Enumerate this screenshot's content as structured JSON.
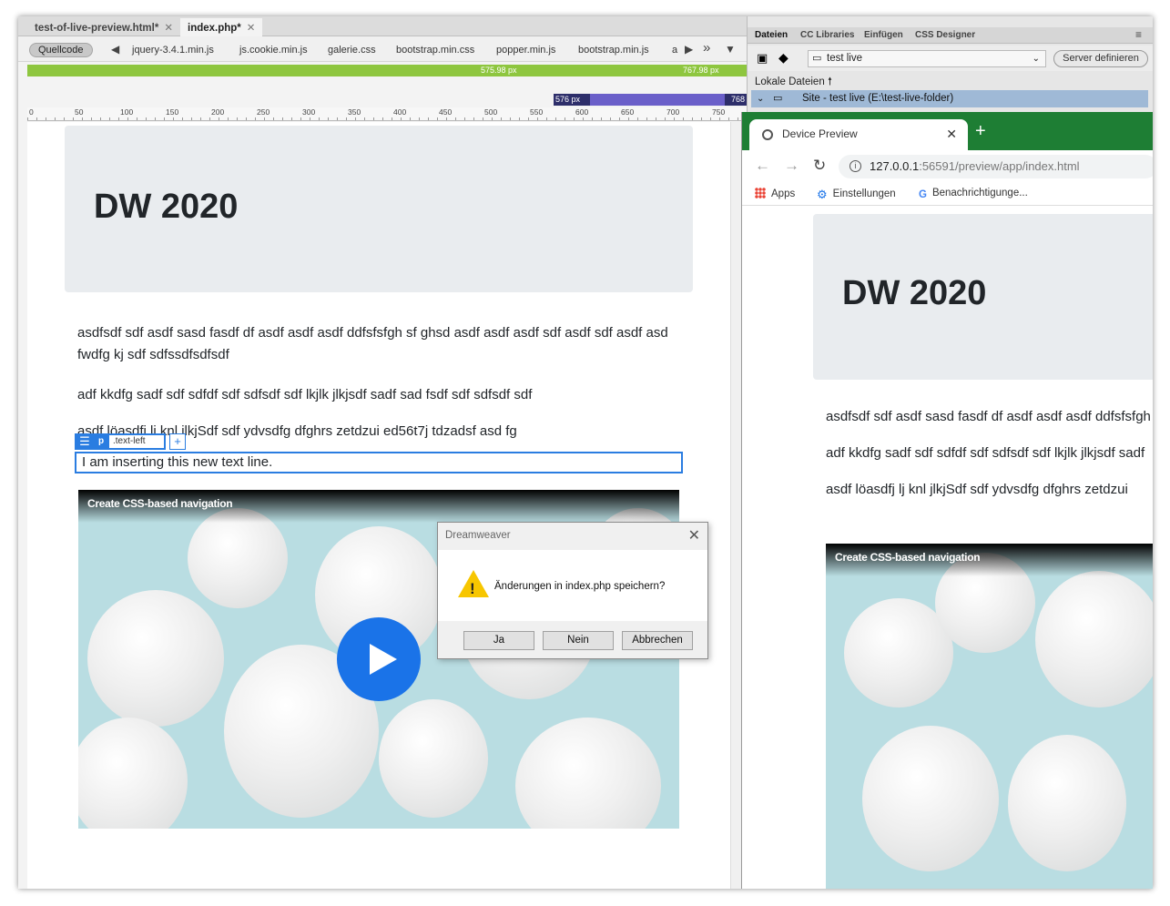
{
  "doc_tabs": [
    {
      "label": "test-of-live-preview.html*"
    },
    {
      "label": "index.php*"
    }
  ],
  "related": {
    "source_pill": "Quellcode",
    "files": [
      "jquery-3.4.1.min.js",
      "js.cookie.min.js",
      "galerie.css",
      "bootstrap.min.css",
      "popper.min.js",
      "bootstrap.min.js",
      "a"
    ]
  },
  "media_queries": {
    "green_1": "575.98 px",
    "green_2": "767.98 px",
    "blue_start": "576 px",
    "blue_end": "768"
  },
  "ruler_ticks": [
    "0",
    "50",
    "100",
    "150",
    "200",
    "250",
    "300",
    "350",
    "400",
    "450",
    "500",
    "550",
    "600",
    "650",
    "700",
    "750"
  ],
  "editor_page": {
    "heading": "DW 2020",
    "paragraphs": [
      "asdfsdf sdf asdf sasd fasdf df asdf asdf asdf ddfsfsfgh sf ghsd asdf asdf asdf sdf asdf sdf asdf asd fwdfg kj sdf sdfssdfsdfsdf",
      "adf kkdfg sadf sdf sdfdf sdf sdfsdf sdf lkjlk jlkjsdf sadf sad fsdf sdf sdfsdf sdf",
      "asdf löasdfj lj knl jlkjSdf sdf ydvsdfg dfghrs zetdzui ed56t7j tdzadsf asd fg"
    ],
    "element_tag": "p",
    "element_class": ".text-left",
    "selected_text": "I am inserting this new text line.",
    "video_title": "Create CSS-based navigation"
  },
  "dialog": {
    "title": "Dreamweaver",
    "message": "Änderungen in index.php speichern?",
    "yes": "Ja",
    "no": "Nein",
    "cancel": "Abbrechen"
  },
  "panel": {
    "tabs": [
      "Dateien",
      "CC Libraries",
      "Einfügen",
      "CSS Designer"
    ],
    "site_select": "test live",
    "server_button": "Server definieren",
    "local_files": "Lokale Dateien",
    "site_row": "Site - test live (E:\\test-live-folder)"
  },
  "browser": {
    "tab_title": "Device Preview",
    "url_host": "127.0.0.1",
    "url_rest": ":56591/preview/app/index.html",
    "bookmarks": [
      "Apps",
      "Einstellungen",
      "Benachrichtigunge..."
    ],
    "heading": "DW 2020",
    "paragraphs": [
      "asdfsdf sdf asdf sasd fasdf df asdf asdf asdf ddfsfsfgh",
      "adf kkdfg sadf sdf sdfdf sdf sdfsdf sdf lkjlk jlkjsdf sadf",
      "asdf löasdfj lj knl jlkjSdf sdf ydvsdfg dfghrs zetdzui"
    ],
    "video_title": "Create CSS-based navigation"
  },
  "colors": {
    "accent_blue": "#2a7de1",
    "mq_green": "#8ec63f",
    "mq_purple": "#6a5fc9",
    "browser_tabbar": "#1e7e34"
  }
}
